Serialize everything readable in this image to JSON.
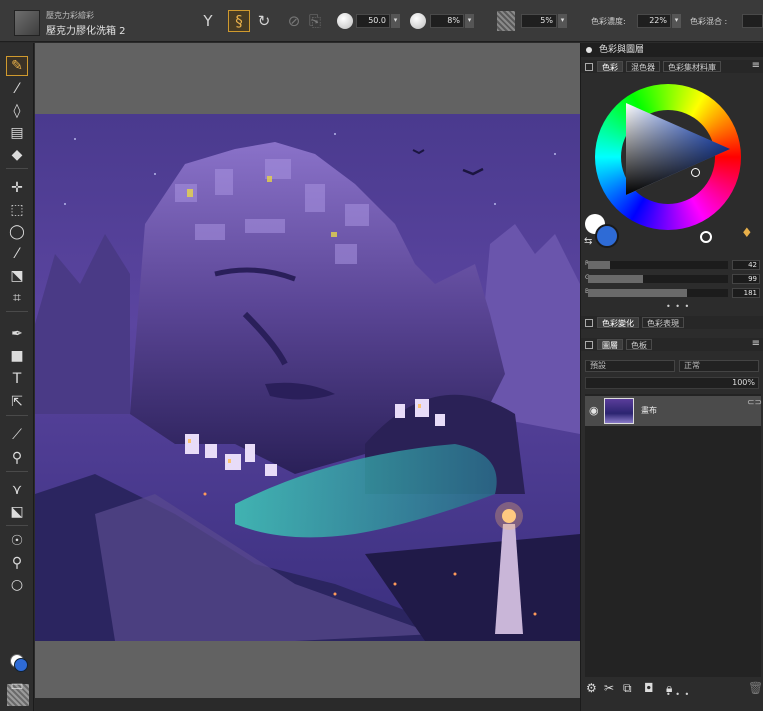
{
  "property_bar": {
    "brush_category": "壓克力彩繪彩",
    "brush_name": "壓克力膠化洗箱 2",
    "size_value": "50.0",
    "opacity_value": "8%",
    "grain_value": "5%",
    "color_intensity_label": "色彩濃度:",
    "color_intensity_value": "22%",
    "color_mix_label": "色彩混合 :",
    "icons": [
      "brush-tool-icon",
      "dab-type-icon",
      "stroke-attr-icon",
      "eraser-mode-icon",
      "clone-source-icon"
    ]
  },
  "toolbox": {
    "tools": [
      "brush",
      "dropper",
      "paint-bucket",
      "gradient",
      "eraser",
      "layer-adjuster",
      "rectangular-selection",
      "lasso",
      "magic-wand",
      "transform",
      "crop",
      "pen",
      "rectangle-shape",
      "text",
      "shape-selection",
      "cloner",
      "rubber-stamp",
      "mirror",
      "divine-proportion",
      "grabber",
      "magnifier",
      "rotate-page"
    ],
    "colors": {
      "foreground": "#ffffff",
      "background": "#2e6bd6"
    }
  },
  "color_panel": {
    "title": "色彩與圖層",
    "tabs": [
      "色彩",
      "混色器",
      "色彩集材料庫"
    ],
    "sliders": [
      {
        "letter": "R",
        "value": "42",
        "fraction": 0.16
      },
      {
        "letter": "G",
        "value": "99",
        "fraction": 0.39
      },
      {
        "letter": "B",
        "value": "181",
        "fraction": 0.71
      }
    ],
    "more": "• • •"
  },
  "variability_panel": {
    "tabs": [
      "色彩變化",
      "色彩表現"
    ]
  },
  "layers_panel": {
    "tabs": [
      "圖層",
      "色板"
    ],
    "blend_mode": "預設",
    "composite": "正常",
    "opacity": "100%",
    "layer": {
      "name": "畫布",
      "visible": true
    },
    "more": "• • •"
  },
  "accent_color": "#d09a2e"
}
